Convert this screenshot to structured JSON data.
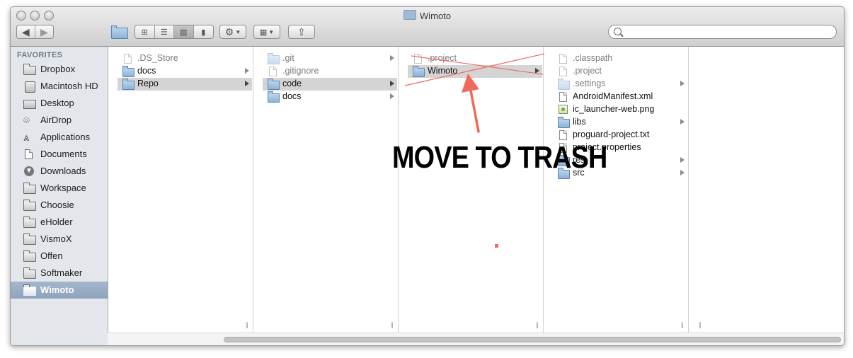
{
  "window": {
    "title": "Wimoto"
  },
  "toolbar": {
    "nav": [
      "back",
      "forward"
    ],
    "view_modes": [
      "icon-view",
      "list-view",
      "column-view",
      "coverflow-view"
    ],
    "active_view": "column-view",
    "action_menu": "gear-icon",
    "arrange_menu": "arrange-icon",
    "share": "share-icon",
    "search_placeholder": ""
  },
  "sidebar": {
    "heading": "FAVORITES",
    "items": [
      {
        "label": "Dropbox",
        "icon": "folder-icon"
      },
      {
        "label": "Macintosh HD",
        "icon": "hard-drive-icon"
      },
      {
        "label": "Desktop",
        "icon": "desktop-icon"
      },
      {
        "label": "AirDrop",
        "icon": "airdrop-icon"
      },
      {
        "label": "Applications",
        "icon": "applications-icon"
      },
      {
        "label": "Documents",
        "icon": "documents-icon"
      },
      {
        "label": "Downloads",
        "icon": "downloads-icon"
      },
      {
        "label": "Workspace",
        "icon": "folder-icon"
      },
      {
        "label": "Choosie",
        "icon": "folder-icon"
      },
      {
        "label": "eHolder",
        "icon": "folder-icon"
      },
      {
        "label": "VismoX",
        "icon": "folder-icon"
      },
      {
        "label": "Offen",
        "icon": "folder-icon"
      },
      {
        "label": "Softmaker",
        "icon": "folder-icon"
      },
      {
        "label": "Wimoto",
        "icon": "folder-icon",
        "selected": true
      }
    ]
  },
  "columns": [
    {
      "items": [
        {
          "label": ".DS_Store",
          "kind": "file",
          "hidden": true
        },
        {
          "label": "docs",
          "kind": "folder",
          "has_children": true
        },
        {
          "label": "Repo",
          "kind": "folder",
          "has_children": true,
          "selected": true
        }
      ]
    },
    {
      "items": [
        {
          "label": ".git",
          "kind": "folder",
          "hidden": true,
          "has_children": true
        },
        {
          "label": ".gitignore",
          "kind": "file",
          "hidden": true
        },
        {
          "label": "code",
          "kind": "folder",
          "has_children": true,
          "selected": true
        },
        {
          "label": "docs",
          "kind": "folder",
          "has_children": true
        }
      ]
    },
    {
      "items": [
        {
          "label": ".project",
          "kind": "file",
          "hidden": true
        },
        {
          "label": "Wimoto",
          "kind": "folder",
          "has_children": true,
          "selected": true
        }
      ]
    },
    {
      "items": [
        {
          "label": ".classpath",
          "kind": "file",
          "hidden": true
        },
        {
          "label": ".project",
          "kind": "file",
          "hidden": true
        },
        {
          "label": ".settings",
          "kind": "folder",
          "hidden": true,
          "has_children": true
        },
        {
          "label": "AndroidManifest.xml",
          "kind": "file"
        },
        {
          "label": "ic_launcher-web.png",
          "kind": "image"
        },
        {
          "label": "libs",
          "kind": "folder",
          "has_children": true
        },
        {
          "label": "proguard-project.txt",
          "kind": "file"
        },
        {
          "label": "project.properties",
          "kind": "file"
        },
        {
          "label": "res",
          "kind": "folder",
          "has_children": true
        },
        {
          "label": "src",
          "kind": "folder",
          "has_children": true
        }
      ]
    },
    {
      "items": []
    }
  ],
  "annotation": {
    "text": "MOVE TO TRASH",
    "color": "#f06a5a"
  },
  "colors": {
    "sidebar_bg": "#e3e7ec",
    "sidebar_selected": "#8ea3bd",
    "row_selected": "#d4d4d4",
    "annotation_red": "#f06a5a"
  }
}
